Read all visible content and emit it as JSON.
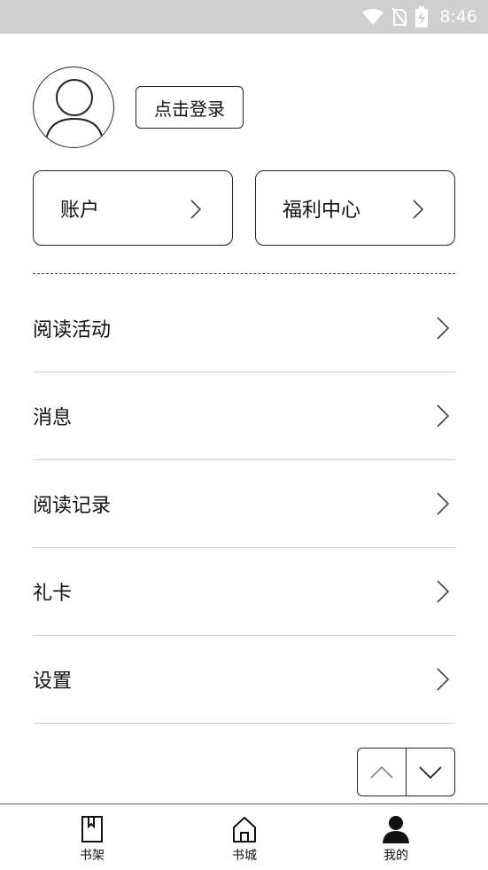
{
  "status_bar": {
    "time": "8:46"
  },
  "profile": {
    "login_label": "点击登录"
  },
  "cards": [
    {
      "label": "账户"
    },
    {
      "label": "福利中心"
    }
  ],
  "menu": {
    "items": [
      {
        "label": "阅读活动"
      },
      {
        "label": "消息"
      },
      {
        "label": "阅读记录"
      },
      {
        "label": "礼卡"
      },
      {
        "label": "设置"
      }
    ]
  },
  "tabs": [
    {
      "label": "书架",
      "icon": "bookshelf-icon"
    },
    {
      "label": "书城",
      "icon": "home-icon"
    },
    {
      "label": "我的",
      "icon": "person-icon",
      "active": true
    }
  ]
}
